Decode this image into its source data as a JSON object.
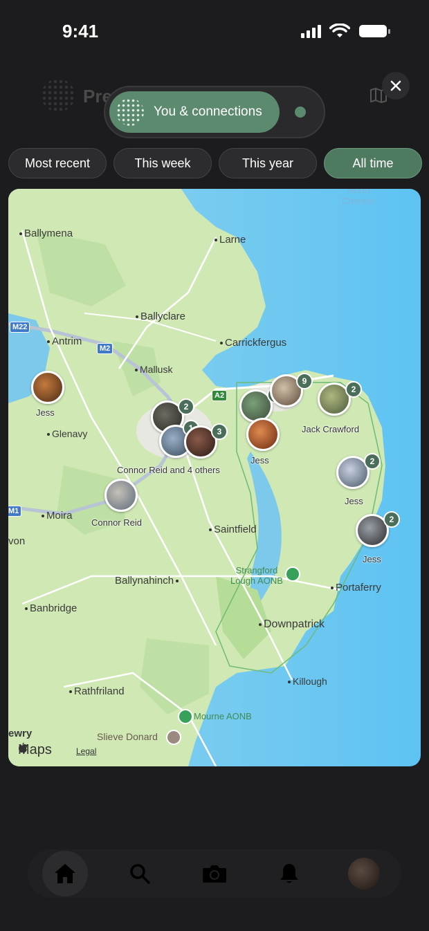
{
  "status_bar": {
    "time": "9:41"
  },
  "header": {
    "title": "Pre"
  },
  "audience": {
    "label": "You & connections"
  },
  "filters": [
    {
      "label": "Most recent",
      "active": false
    },
    {
      "label": "This week",
      "active": false
    },
    {
      "label": "This year",
      "active": false
    },
    {
      "label": "All time",
      "active": true
    }
  ],
  "map": {
    "water_labels": {
      "north_channel": "North\nChannel"
    },
    "places": {
      "ballymena": "Ballymena",
      "larne": "Larne",
      "ballyclare": "Ballyclare",
      "antrim": "Antrim",
      "carrickfergus": "Carrickfergus",
      "mallusk": "Mallusk",
      "glenavy": "Glenavy",
      "moira": "Moira",
      "saintfield": "Saintfield",
      "ballynahinch": "Ballynahinch",
      "portaferry": "Portaferry",
      "banbridge": "Banbridge",
      "downpatrick": "Downpatrick",
      "killough": "Killough",
      "rathfriland": "Rathfriland",
      "newry": "ewry",
      "lurgan": "von"
    },
    "roads": {
      "m22": "M22",
      "m2": "M2",
      "a2": "A2",
      "m1": "M1"
    },
    "pois": {
      "strangford": "Strangford\nLough AONB",
      "mourne": "Mourne AONB",
      "slieve_donard": "Slieve Donard"
    },
    "pins": [
      {
        "id": "jess-west",
        "title": "Jess",
        "count": ""
      },
      {
        "id": "belfast-1",
        "title": "",
        "count": "2"
      },
      {
        "id": "belfast-2",
        "title": "",
        "count": "1"
      },
      {
        "id": "belfast-3",
        "title": "Connor Reid and 4 others",
        "count": "3"
      },
      {
        "id": "connor",
        "title": "Connor Reid",
        "count": ""
      },
      {
        "id": "bangor-1",
        "title": "",
        "count": "2"
      },
      {
        "id": "bangor-2",
        "title": "",
        "count": "9"
      },
      {
        "id": "bangor-3",
        "title": "Jess",
        "count": ""
      },
      {
        "id": "jack",
        "title": "Jack Crawford",
        "count": "2"
      },
      {
        "id": "jess-east",
        "title": "Jess",
        "count": "2"
      },
      {
        "id": "jess-south",
        "title": "Jess",
        "count": "2"
      }
    ],
    "attribution": {
      "logo": "Maps",
      "legal": "Legal"
    }
  },
  "tabbar": {
    "items": [
      "home-icon",
      "search-icon",
      "camera-icon",
      "bell-icon",
      "profile-avatar"
    ]
  }
}
